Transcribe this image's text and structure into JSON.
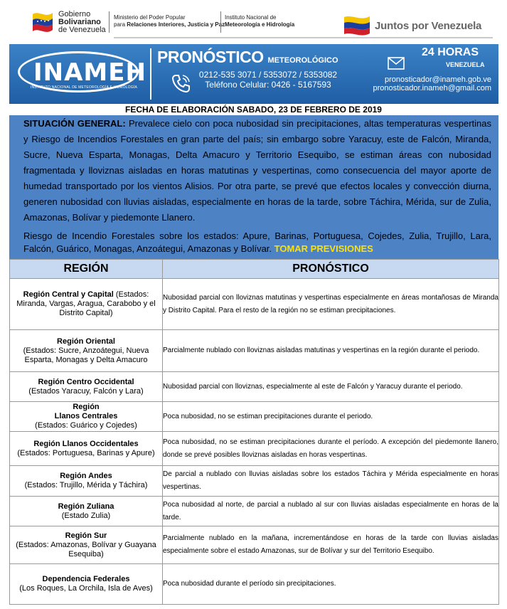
{
  "header": {
    "gov": {
      "line1": "Gobierno",
      "line2": "Bolivariano",
      "line3": "de Venezuela",
      "ministry_line1": "Ministerio del Poder Popular",
      "ministry_line2_pre": "para ",
      "ministry_line2_bold": "Relaciones Interiores, Justicia y Paz",
      "institute_line1": "Instituto Nacional de",
      "institute_line2": "Meteorología e Hidrología",
      "slogan": "Juntos por Venezuela"
    },
    "band": {
      "logo": "INAMEH",
      "logo_sub": "INSTITUTO NACIONAL DE METEOROLOGÍA E HIDROLOGÍA",
      "title": "PRONÓSTICO",
      "title_small": "METEOROLÓGICO",
      "phone1": "0212-535 3071 / 5353072 / 5353082",
      "phone2": "Teléfono Celular: 0426 - 5167593",
      "hours": "24 HORAS",
      "country": "VENEZUELA",
      "email1": "pronosticador@inameh.gob.ve",
      "email2": "pronosticador.inameh@gmail.com"
    }
  },
  "date_line": "FECHA DE ELABORACIÓN SABADO, 23 DE FEBRERO DE 2019",
  "situation": {
    "label": "SITUACIÓN GENERAL:",
    "text": " Prevalece cielo con poca nubosidad sin precipitaciones, altas temperaturas vespertinas y Riesgo de Incendios Forestales en gran parte del país; sin embargo sobre Yaracuy, este de Falcón, Miranda, Sucre, Nueva Esparta, Monagas, Delta Amacuro y Territorio Esequibo, se estiman áreas con nubosidad fragmentada y lloviznas aisladas en horas matutinas y vespertinas, como consecuencia del mayor aporte de humedad transportado por los vientos Alisios. Por otra parte, se prevé que efectos locales y convección diurna, generen nubosidad con lluvias aisladas, especialmente en horas de la tarde, sobre Táchira, Mérida, sur de Zulia, Amazonas, Bolívar y piedemonte Llanero.",
    "risk": "Riesgo de Incendio Forestales sobre los estados: Apure, Barinas, Portuguesa, Cojedes, Zulia, Trujillo, Lara, Falcón, Guárico, Monagas, Anzoátegui, Amazonas y Bolívar.",
    "warning": " TOMAR PREVISIONES"
  },
  "table": {
    "col_region": "REGIÓN",
    "col_forecast": "PRONÓSTICO",
    "rows": [
      {
        "name": "Región Central y Capital",
        "detail": " (Estados: Miranda, Vargas, Aragua, Carabobo y el Distrito Capital)",
        "forecast": "Nubosidad parcial  con lloviznas matutinas y vespertinas especialmente en áreas montañosas de Miranda y Distrito Capital. Para el resto de la región no se estiman precipitaciones."
      },
      {
        "name": "Región Oriental",
        "detail": "(Estados: Sucre, Anzoátegui, Nueva Esparta, Monagas y Delta Amacuro",
        "forecast": "Parcialmente nublado con lloviznas aisladas matutinas y vespertinas en la región durante el periodo."
      },
      {
        "name": "Región Centro Occidental",
        "detail": "(Estados Yaracuy, Falcón y Lara)",
        "forecast": "Nubosidad parcial con lloviznas, especialmente al este de Falcón y  Yaracuy  durante el periodo."
      },
      {
        "name": "Región\nLlanos Centrales",
        "detail": "(Estados: Guárico y Cojedes)",
        "forecast": "Poca nubosidad, no se estiman precipitaciones durante el periodo."
      },
      {
        "name": "Región Llanos Occidentales",
        "detail": "(Estados: Portuguesa, Barinas y Apure)",
        "forecast": "Poca nubosidad, no se estiman precipitaciones durante el período. A excepción del piedemonte llanero, donde se prevé posibles lloviznas aisladas en horas vespertinas."
      },
      {
        "name": "Región Andes",
        "detail": "(Estados: Trujillo, Mérida y Táchira)",
        "forecast": "De parcial a nublado con lluvias aisladas sobre los estados Táchira y Mérida especialmente en horas vespertinas."
      },
      {
        "name": "Región Zuliana",
        "detail": "(Estado Zulia)",
        "forecast": "Poca nubosidad al norte, de parcial a nublado al sur con lluvias aisladas especialmente en horas de la tarde."
      },
      {
        "name": "Región Sur",
        "detail": "(Estados: Amazonas, Bolívar y Guayana Esequiba)",
        "forecast": "Parcialmente nublado en la mañana, incrementándose en horas de la tarde con lluvias aisladas especialmente sobre el  estado Amazonas, sur de Bolívar y sur del Territorio Esequibo."
      },
      {
        "name": "Dependencia Federales",
        "detail": "(Los Roques, La Orchila, Isla de Aves)",
        "forecast": "Poca nubosidad durante el período sin precipitaciones."
      }
    ]
  },
  "colors": {
    "band": "#2b70b8",
    "situation_bg": "#4d82c5",
    "warning": "#ffe100",
    "table_header": "#c7d9f0"
  },
  "icons": [
    "venezuela-flag-icon",
    "phone-icon",
    "mail-icon"
  ]
}
